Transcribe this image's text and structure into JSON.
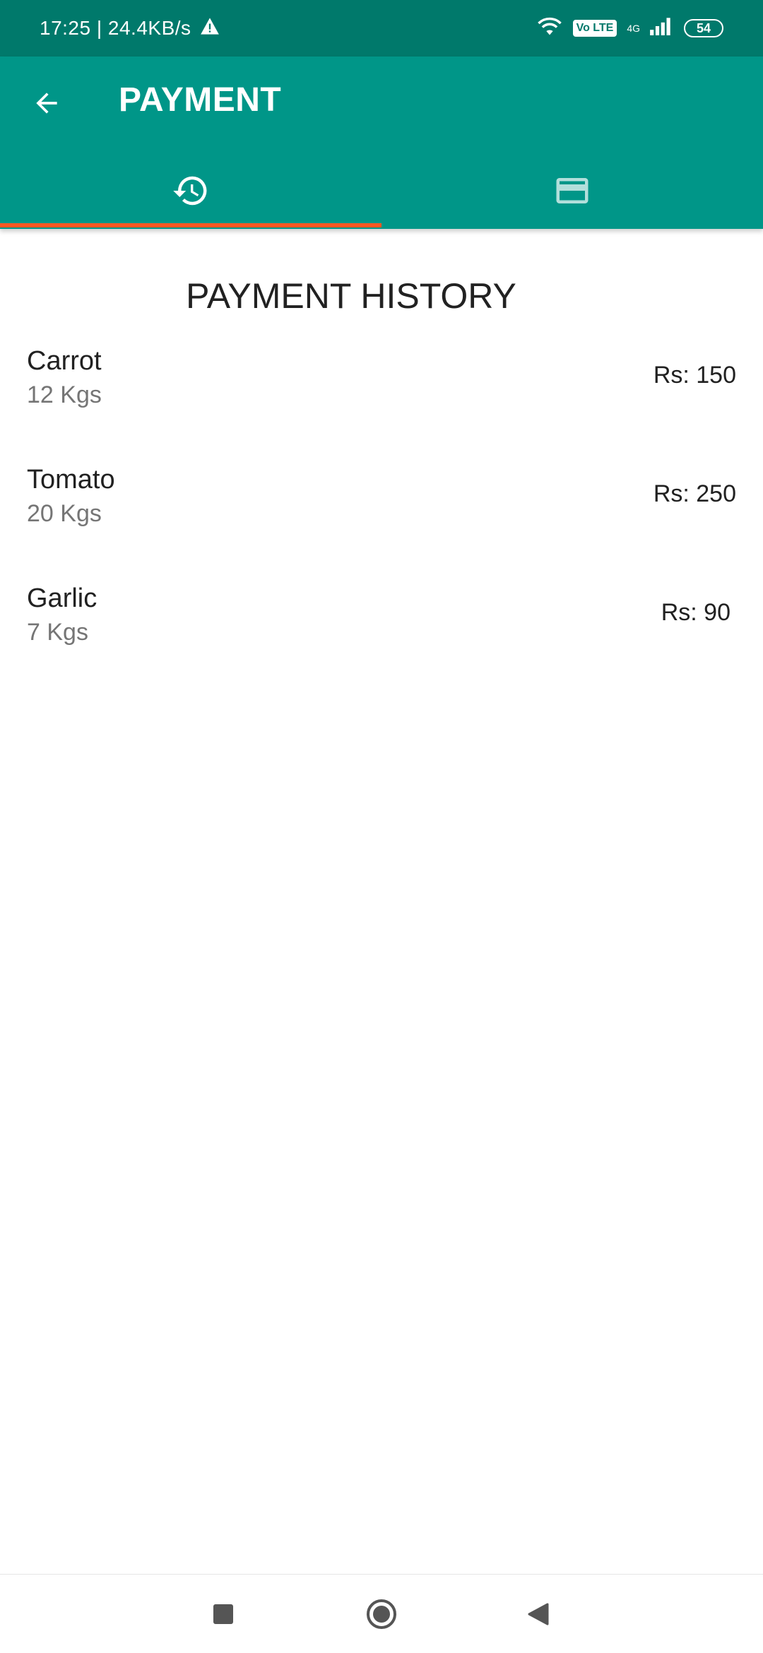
{
  "status_bar": {
    "time_speed": "17:25 | 24.4KB/s",
    "volte_badge": "Vo LTE",
    "network_label": "4G",
    "battery_level": "54",
    "icons": [
      "warning-icon",
      "wifi-icon",
      "volte-icon",
      "signal-icon",
      "battery-icon"
    ]
  },
  "app_bar": {
    "title": "PAYMENT",
    "color": "#009688",
    "status_color": "#00796b",
    "back_icon": "arrow-back-icon"
  },
  "tabs": [
    {
      "icon": "history-icon",
      "selected": true
    },
    {
      "icon": "credit-card-icon",
      "selected": false
    }
  ],
  "indicator_color": "#ff5722",
  "section_title": "PAYMENT HISTORY",
  "payments": [
    {
      "name": "Carrot",
      "quantity": "12 Kgs",
      "price": "Rs: 150"
    },
    {
      "name": "Tomato",
      "quantity": "20 Kgs",
      "price": "Rs: 250"
    },
    {
      "name": "Garlic",
      "quantity": "7 Kgs",
      "price": "Rs: 90"
    }
  ],
  "nav_bar": {
    "icons": [
      "recents-square-icon",
      "home-circle-icon",
      "back-triangle-icon"
    ]
  }
}
